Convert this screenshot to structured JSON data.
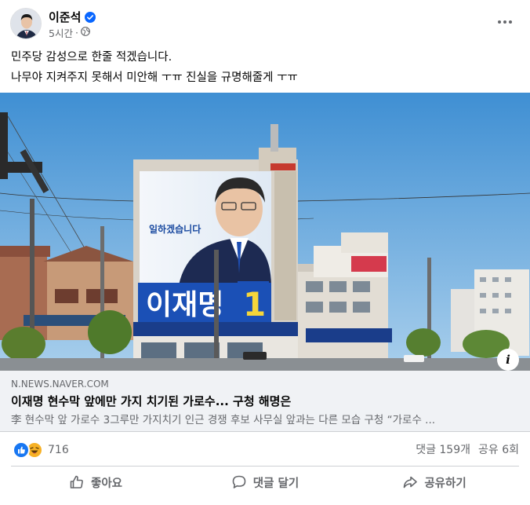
{
  "post": {
    "author": "이준석",
    "time": "5시간",
    "privacy_icon": "globe-icon",
    "lines": [
      "민주당 감성으로 한줄 적겠습니다.",
      "나무야 지켜주지 못해서 미안해 ㅜㅠ 진실을 규명해줄게 ㅜㅠ"
    ]
  },
  "media": {
    "banner_slogan": "일하겠습니다",
    "banner_name": "이재명",
    "banner_number": "1",
    "info_label": "i"
  },
  "link": {
    "domain": "N.NEWS.NAVER.COM",
    "title": "이재명 현수막 앞에만 가지 치기된 가로수... 구청 해명은",
    "description": "李 현수막 앞 가로수 3그루만 가지치기 인근 경쟁 후보 사무실 앞과는 다른 모습 구청 “가로수 ..."
  },
  "stats": {
    "reaction_count": "716",
    "comments": "댓글 159개",
    "shares": "공유 6회"
  },
  "actions": {
    "like": "좋아요",
    "comment": "댓글 달기",
    "share": "공유하기"
  },
  "colors": {
    "verified": "#0866ff",
    "like_reaction": "#1877f2",
    "haha_reaction": "#f7b125",
    "link_bg": "#f0f2f5",
    "secondary_text": "#65676b"
  }
}
